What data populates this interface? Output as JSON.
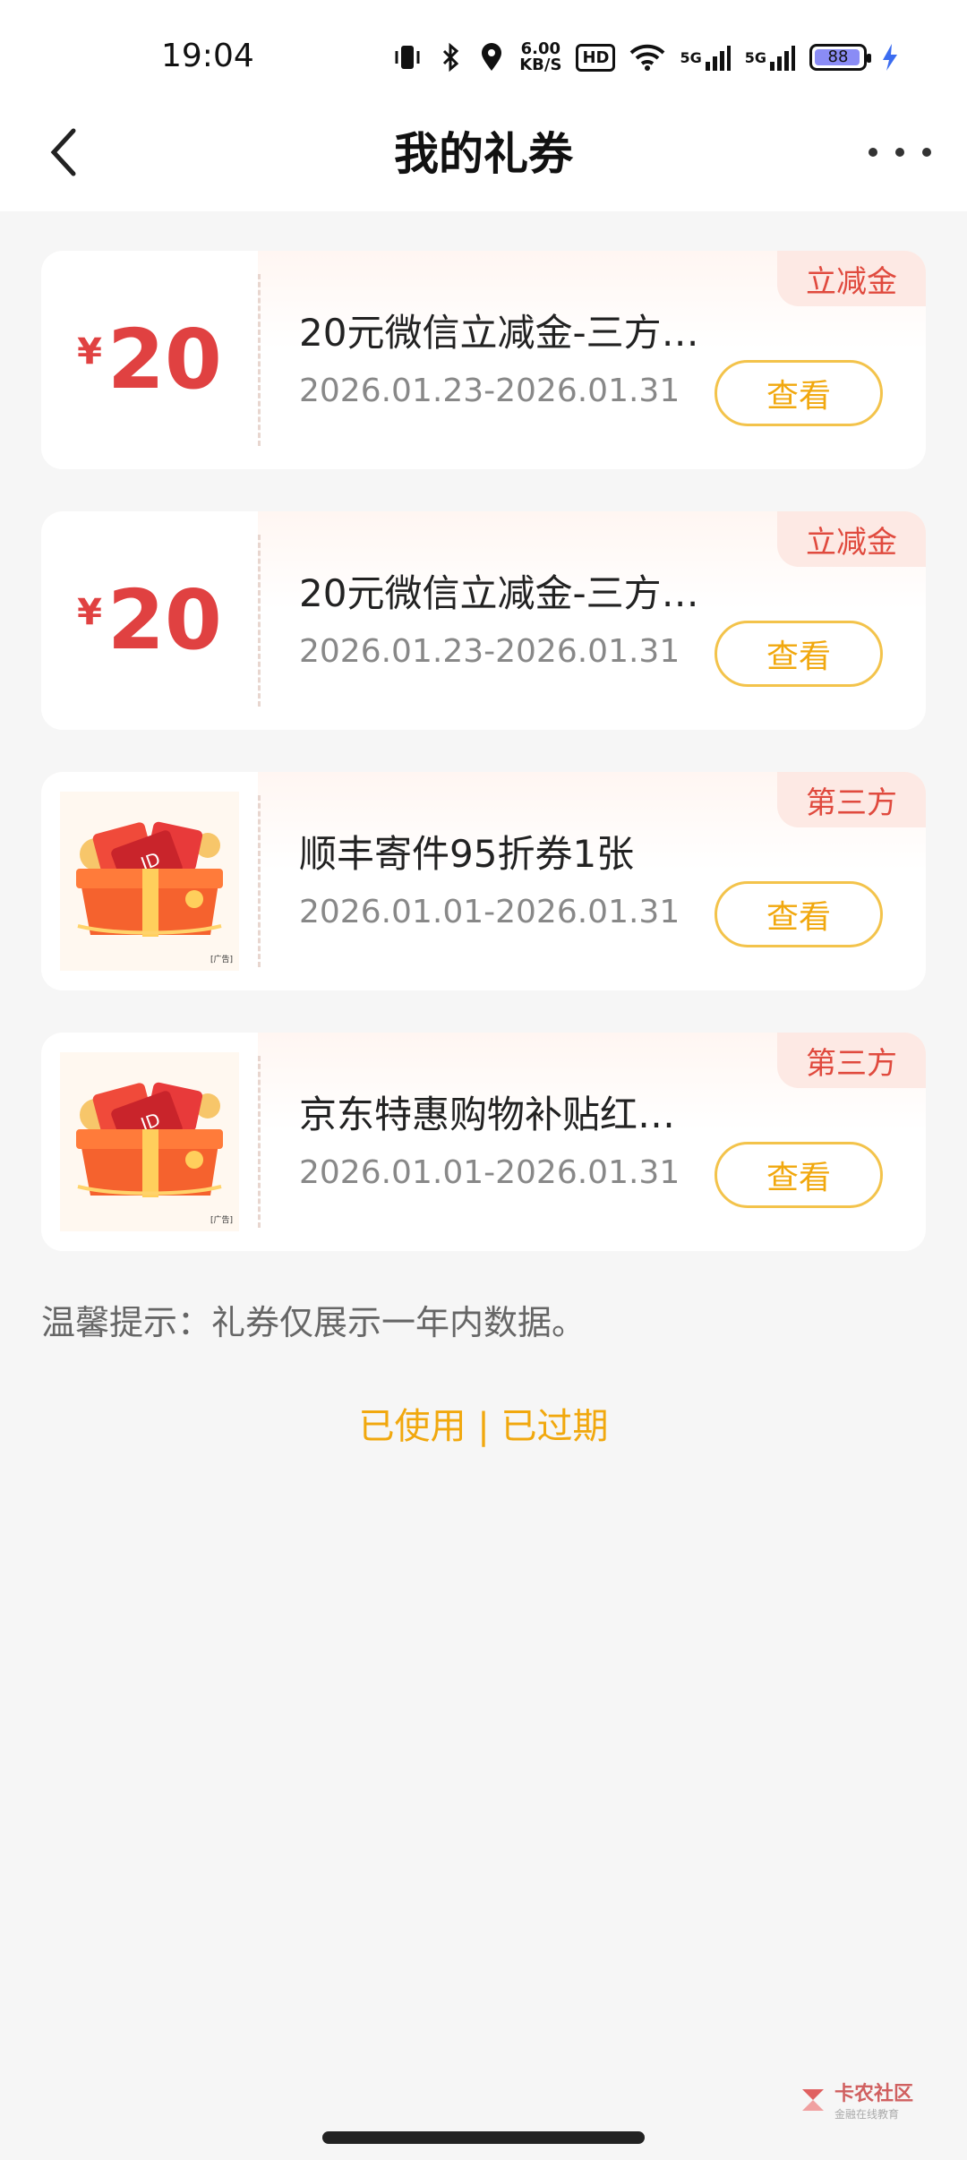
{
  "status_bar": {
    "time": "19:04",
    "net_speed_value": "6.00",
    "net_speed_unit": "KB/S",
    "hd_label": "HD",
    "signal1_label": "5G",
    "signal2_label": "5G",
    "battery": "88"
  },
  "header": {
    "title": "我的礼券"
  },
  "coupons": [
    {
      "type": "amount",
      "currency": "¥",
      "amount": "20",
      "title": "20元微信立减金-三方…",
      "date_range": "2026.01.23-2026.01.31",
      "view_label": "查看",
      "tag": "立减金"
    },
    {
      "type": "amount",
      "currency": "¥",
      "amount": "20",
      "title": "20元微信立减金-三方…",
      "date_range": "2026.01.23-2026.01.31",
      "view_label": "查看",
      "tag": "立减金"
    },
    {
      "type": "image",
      "title": "顺丰寄件95折券1张",
      "date_range": "2026.01.01-2026.01.31",
      "view_label": "查看",
      "tag": "第三方",
      "image_label": "ID",
      "ad_mark": "[广告]"
    },
    {
      "type": "image",
      "title": "京东特惠购物补贴红…",
      "date_range": "2026.01.01-2026.01.31",
      "view_label": "查看",
      "tag": "第三方",
      "image_label": "ID",
      "ad_mark": "[广告]"
    }
  ],
  "tip": "温馨提示：礼券仅展示一年内数据。",
  "history_link": "已使用 | 已过期",
  "watermark": {
    "title": "卡农社区",
    "subtitle": "金融在线教育"
  },
  "colors": {
    "accent": "#f1a80e",
    "amount": "#e04141",
    "tag_bg": "#fde9e4"
  }
}
